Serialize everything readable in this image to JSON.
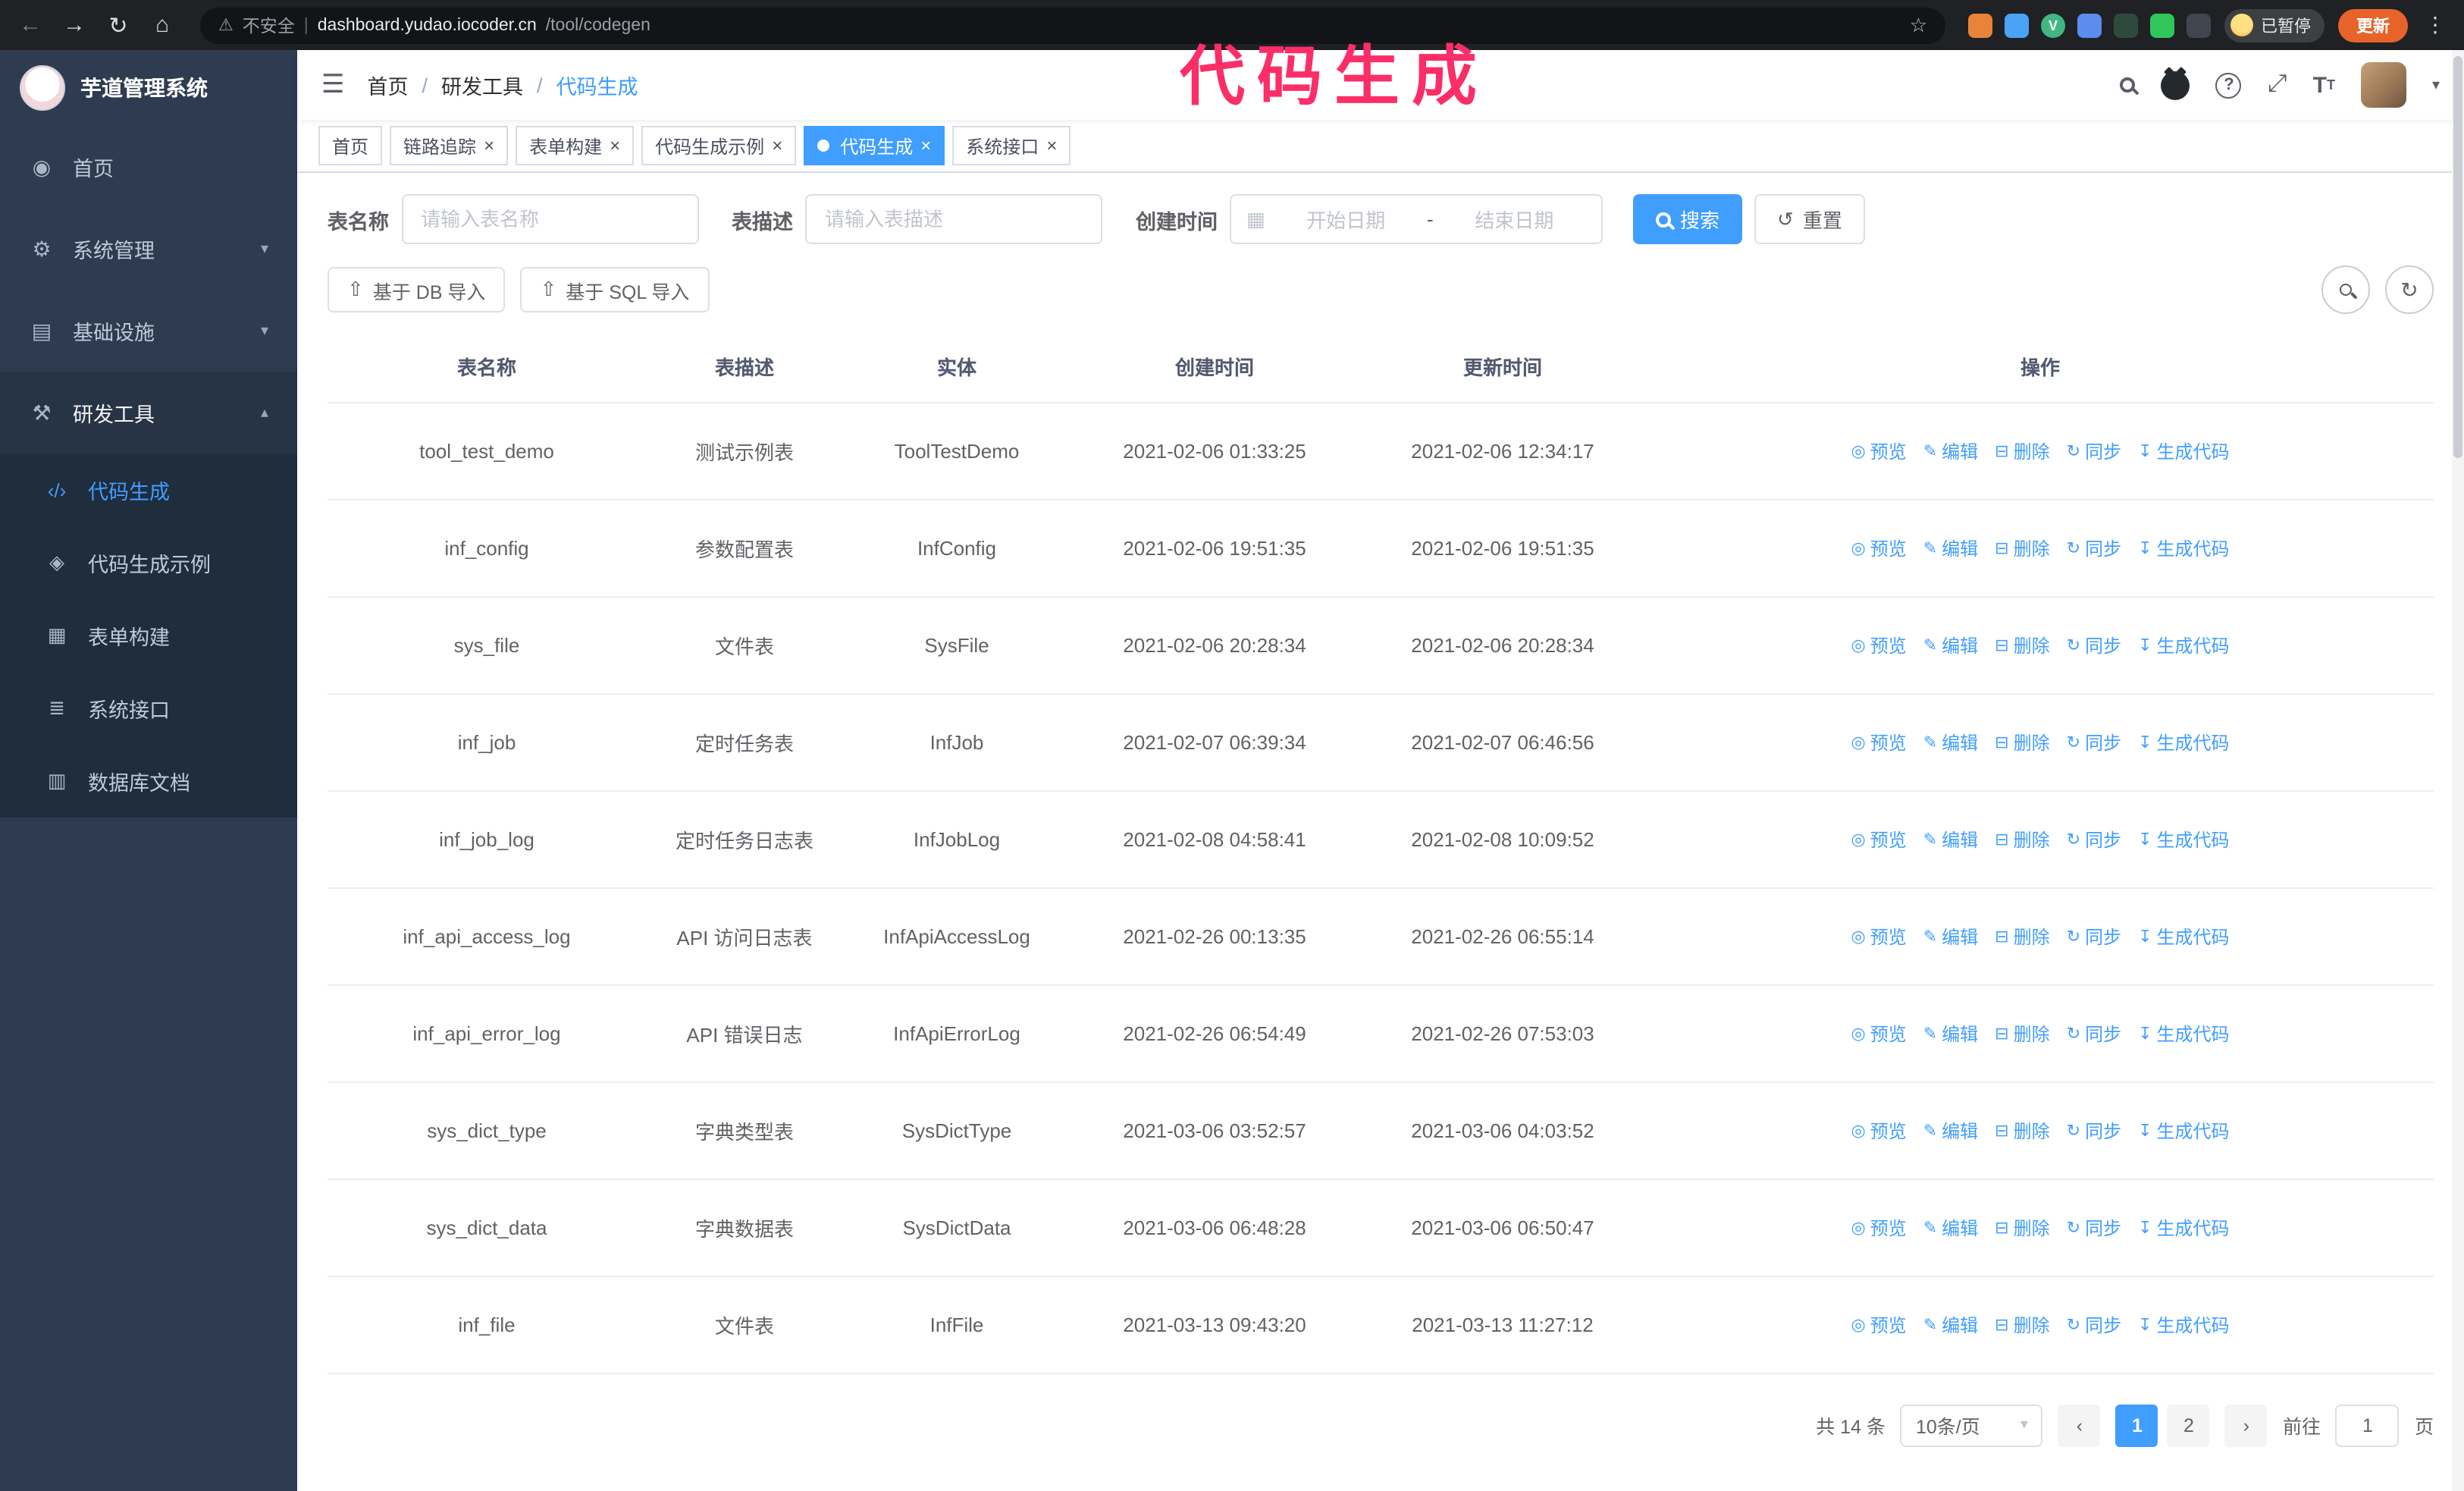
{
  "chrome": {
    "security_warning": "不安全",
    "host": "dashboard.yudao.iocoder.cn",
    "path": "/tool/codegen",
    "paused_badge": "已暂停",
    "update_label": "更新",
    "nav_icons": [
      "back-icon",
      "forward-icon",
      "reload-icon",
      "home-icon",
      "bookmark-star-icon"
    ],
    "extensions": [
      {
        "name": "fox-extension-icon",
        "color": "#e8833a",
        "shape": "square",
        "glyph": ""
      },
      {
        "name": "water-drop-extension-icon",
        "color": "#4ba3f7",
        "shape": "square",
        "glyph": ""
      },
      {
        "name": "vue-devtools-extension-icon",
        "color": "#41b883",
        "shape": "circle",
        "glyph": "V"
      },
      {
        "name": "accounts-extension-icon",
        "color": "#5b8def",
        "shape": "square",
        "glyph": ""
      },
      {
        "name": "screen-capture-extension-icon",
        "color": "#2f4a3c",
        "shape": "square",
        "glyph": ""
      },
      {
        "name": "leaf-extension-icon",
        "color": "#30c65a",
        "shape": "square",
        "glyph": ""
      },
      {
        "name": "puzzle-extension-icon",
        "color": "#41454d",
        "shape": "square",
        "glyph": ""
      }
    ]
  },
  "annotation": {
    "text": "代码生成",
    "color": "#fb2e67"
  },
  "sidebar": {
    "logo_title": "芋道管理系统",
    "items": [
      {
        "label": "首页",
        "icon": "dashboard-icon",
        "glyph": "◉",
        "expandable": false,
        "expanded": false
      },
      {
        "label": "系统管理",
        "icon": "gear-icon",
        "glyph": "⚙",
        "expandable": true,
        "expanded": false
      },
      {
        "label": "基础设施",
        "icon": "infrastructure-icon",
        "glyph": "▤",
        "expandable": true,
        "expanded": false
      },
      {
        "label": "研发工具",
        "icon": "dev-tools-icon",
        "glyph": "⚒",
        "expandable": true,
        "expanded": true
      }
    ],
    "submenu": [
      {
        "label": "代码生成",
        "icon": "code-icon",
        "glyph": "‹/›",
        "active": true
      },
      {
        "label": "代码生成示例",
        "icon": "example-badge-icon",
        "glyph": "◈",
        "active": false
      },
      {
        "label": "表单构建",
        "icon": "form-builder-icon",
        "glyph": "▦",
        "active": false
      },
      {
        "label": "系统接口",
        "icon": "api-icon",
        "glyph": "≣",
        "active": false
      },
      {
        "label": "数据库文档",
        "icon": "database-doc-icon",
        "glyph": "▥",
        "active": false
      }
    ]
  },
  "header": {
    "breadcrumb": [
      "首页",
      "研发工具",
      "代码生成"
    ],
    "icons": [
      "search-icon",
      "github-icon",
      "question-icon",
      "fullscreen-icon",
      "font-size-icon",
      "chevron-down-icon"
    ]
  },
  "tabs": [
    {
      "label": "首页",
      "closable": false,
      "active": false
    },
    {
      "label": "链路追踪",
      "closable": true,
      "active": false
    },
    {
      "label": "表单构建",
      "closable": true,
      "active": false
    },
    {
      "label": "代码生成示例",
      "closable": true,
      "active": false
    },
    {
      "label": "代码生成",
      "closable": true,
      "active": true
    },
    {
      "label": "系统接口",
      "closable": true,
      "active": false
    }
  ],
  "filters": {
    "table_name_label": "表名称",
    "table_name_placeholder": "请输入表名称",
    "table_desc_label": "表描述",
    "table_desc_placeholder": "请输入表描述",
    "create_time_label": "创建时间",
    "start_date_placeholder": "开始日期",
    "range_separator": "-",
    "end_date_placeholder": "结束日期",
    "search_label": "搜索",
    "reset_label": "重置"
  },
  "toolbar": {
    "import_db_label": "基于 DB 导入",
    "import_sql_label": "基于 SQL 导入"
  },
  "table": {
    "columns": [
      "表名称",
      "表描述",
      "实体",
      "创建时间",
      "更新时间",
      "操作"
    ],
    "actions": [
      {
        "label": "预览",
        "name": "preview",
        "icon": "eye-icon",
        "glyph": "◎"
      },
      {
        "label": "编辑",
        "name": "edit",
        "icon": "edit-pencil-icon",
        "glyph": "✎"
      },
      {
        "label": "删除",
        "name": "delete",
        "icon": "trash-icon",
        "glyph": "⊟"
      },
      {
        "label": "同步",
        "name": "sync",
        "icon": "sync-icon",
        "glyph": "↻"
      },
      {
        "label": "生成代码",
        "name": "generate-code",
        "icon": "download-icon",
        "glyph": "↧"
      }
    ],
    "rows": [
      {
        "name": "tool_test_demo",
        "description": "测试示例表",
        "entity": "ToolTestDemo",
        "created_at": "2021-02-06 01:33:25",
        "updated_at": "2021-02-06 12:34:17"
      },
      {
        "name": "inf_config",
        "description": "参数配置表",
        "entity": "InfConfig",
        "created_at": "2021-02-06 19:51:35",
        "updated_at": "2021-02-06 19:51:35"
      },
      {
        "name": "sys_file",
        "description": "文件表",
        "entity": "SysFile",
        "created_at": "2021-02-06 20:28:34",
        "updated_at": "2021-02-06 20:28:34"
      },
      {
        "name": "inf_job",
        "description": "定时任务表",
        "entity": "InfJob",
        "created_at": "2021-02-07 06:39:34",
        "updated_at": "2021-02-07 06:46:56"
      },
      {
        "name": "inf_job_log",
        "description": "定时任务日志表",
        "entity": "InfJobLog",
        "created_at": "2021-02-08 04:58:41",
        "updated_at": "2021-02-08 10:09:52"
      },
      {
        "name": "inf_api_access_log",
        "description": "API 访问日志表",
        "entity": "InfApiAccessLog",
        "created_at": "2021-02-26 00:13:35",
        "updated_at": "2021-02-26 06:55:14"
      },
      {
        "name": "inf_api_error_log",
        "description": "API 错误日志",
        "entity": "InfApiErrorLog",
        "created_at": "2021-02-26 06:54:49",
        "updated_at": "2021-02-26 07:53:03"
      },
      {
        "name": "sys_dict_type",
        "description": "字典类型表",
        "entity": "SysDictType",
        "created_at": "2021-03-06 03:52:57",
        "updated_at": "2021-03-06 04:03:52"
      },
      {
        "name": "sys_dict_data",
        "description": "字典数据表",
        "entity": "SysDictData",
        "created_at": "2021-03-06 06:48:28",
        "updated_at": "2021-03-06 06:50:47"
      },
      {
        "name": "inf_file",
        "description": "文件表",
        "entity": "InfFile",
        "created_at": "2021-03-13 09:43:20",
        "updated_at": "2021-03-13 11:27:12"
      }
    ]
  },
  "pagination": {
    "total_label": "共 14 条",
    "page_size_value": "10条/页",
    "prev_label": "‹",
    "next_label": "›",
    "pages": [
      "1",
      "2"
    ],
    "active_page": "1",
    "goto_label": "前往",
    "goto_value": "1",
    "unit_label": "页"
  }
}
